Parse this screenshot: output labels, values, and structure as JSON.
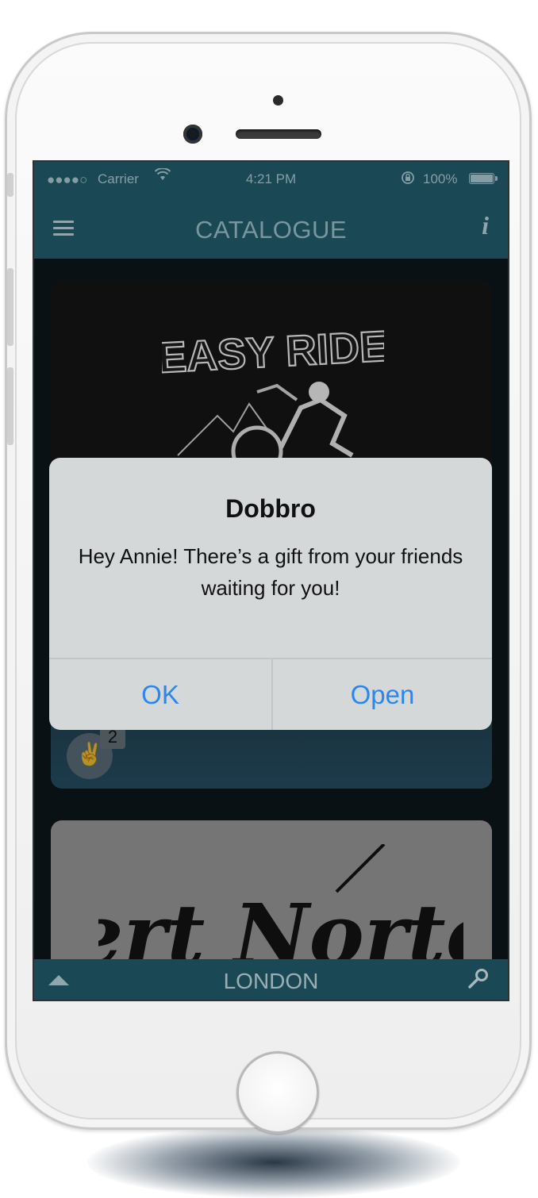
{
  "statusbar": {
    "signal": "●●●●○",
    "carrier": "Carrier",
    "time": "4:21 PM",
    "battery": "100%"
  },
  "navbar": {
    "title": "CATALOGUE"
  },
  "cards": [
    {
      "logo_text": "EASY RIDE",
      "likes": "2"
    },
    {
      "logo_text": "Bert Norton"
    }
  ],
  "bottombar": {
    "city": "LONDON"
  },
  "alert": {
    "title": "Dobbro",
    "message": "Hey Annie! There’s a gift from your friends waiting for you!",
    "ok_label": "OK",
    "open_label": "Open"
  },
  "colors": {
    "bar": "#1f5664",
    "alert_bg": "#d5d8d9",
    "alert_button": "#2a87f0"
  }
}
